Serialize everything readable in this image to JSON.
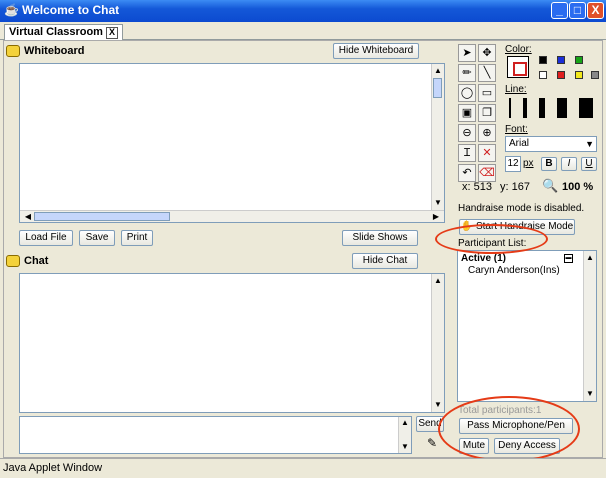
{
  "window": {
    "title": "Welcome to Chat",
    "minimize": "_",
    "maximize": "□",
    "close": "X"
  },
  "tab": {
    "label": "Virtual Classroom",
    "close": "X"
  },
  "whiteboard": {
    "label": "Whiteboard",
    "hide_button": "Hide Whiteboard",
    "load_file": "Load File",
    "save": "Save",
    "print": "Print",
    "slide_shows": "Slide Shows"
  },
  "chat": {
    "label": "Chat",
    "hide_button": "Hide Chat",
    "send": "Send"
  },
  "tools": {
    "color_label": "Color:",
    "line_label": "Line:",
    "font_label": "Font:",
    "font_value": "Arial",
    "font_size": "12",
    "font_size_unit": "px",
    "bold": "B",
    "italic": "I",
    "underline": "U",
    "coord_x": "x: 513",
    "coord_y": "y: 167",
    "zoom": "100 %",
    "colors": [
      "#000000",
      "#1c2fd8",
      "#17a317",
      "#000000",
      "#e01e1e",
      "#f2e81c",
      "#888888"
    ]
  },
  "participants": {
    "handraise_status": "Handraise mode is disabled.",
    "start_handraise": "Start Handraise Mode",
    "list_label": "Participant List:",
    "active_header": "Active (1)",
    "items": [
      "Caryn Anderson(Ins)"
    ],
    "total": "Total participants:1",
    "pass_mic": "Pass Microphone/Pen",
    "mute": "Mute",
    "deny_access": "Deny Access"
  },
  "statusbar": {
    "text": "Java Applet Window"
  }
}
